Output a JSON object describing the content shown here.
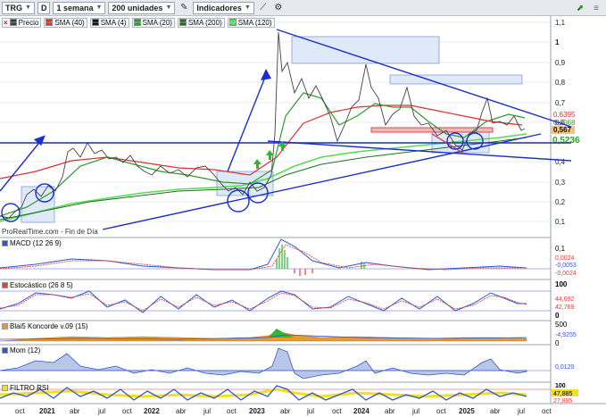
{
  "toolbar": {
    "ticker": "TRG",
    "d_label": "D",
    "period": "1 semana",
    "units": "200 unidades",
    "indicators": "Indicadores"
  },
  "legend": [
    {
      "label": "Precio",
      "color": "#3a3a3a"
    },
    {
      "label": "SMA (40)",
      "color": "#e03030"
    },
    {
      "label": "SMA (4)",
      "color": "#111111"
    },
    {
      "label": "SMA (20)",
      "color": "#2f9a2f"
    },
    {
      "label": "SMA (200)",
      "color": "#1f6f1f"
    },
    {
      "label": "SMA (120)",
      "color": "#55dd55"
    }
  ],
  "source_text": "ProRealTime.com - Fin de Día",
  "price_axis": {
    "ticks": [
      "1,1",
      "1",
      "0,9",
      "0,8",
      "0,7",
      "0,6",
      "0,5",
      "0,4",
      "0,3",
      "0,2",
      "0,1"
    ],
    "tags": [
      {
        "text": "0,6395",
        "color": "#e03030"
      },
      {
        "text": "0,6068",
        "color": "#2f9a2f"
      },
      {
        "text": "0,567",
        "color": "#111111",
        "bg": "#f4c27a"
      },
      {
        "text": "0,5236",
        "color": "#22aa22"
      }
    ]
  },
  "time_axis": [
    "oct",
    "2021",
    "abr",
    "jul",
    "oct",
    "2022",
    "abr",
    "jul",
    "oct",
    "2023",
    "abr",
    "jul",
    "oct",
    "2024",
    "abr",
    "jul",
    "oct",
    "2025",
    "abr",
    "jul",
    "oct"
  ],
  "panels": {
    "macd": {
      "title": "MACD (12 26 9)",
      "ticks": [
        "0,1",
        "0"
      ],
      "tags": [
        "0,0024",
        "-0,0053",
        "-0,0024"
      ]
    },
    "stoch": {
      "title": "Estocástico (26 8 5)",
      "ticks": [
        "100",
        "0"
      ],
      "tags": [
        "44,692",
        "42,769"
      ]
    },
    "blai": {
      "title": "Blai5 Koncorde v.09 (15)",
      "ticks": [
        "500",
        "0"
      ],
      "tags": [
        "-4,9255"
      ]
    },
    "mom": {
      "title": "Mom (12)",
      "ticks": [
        "0"
      ],
      "tags": [
        "0,0120"
      ]
    },
    "rsi": {
      "title": "FILTRO RSI",
      "ticks": [
        "100"
      ],
      "tags": [
        "47,885",
        "27,885"
      ]
    }
  },
  "colors": {
    "grid": "#d8dce3",
    "price": "#444444",
    "sma40": "#e03030",
    "sma20": "#2f9a2f",
    "sma120": "#55dd55",
    "trend": "#1a2fd1"
  }
}
